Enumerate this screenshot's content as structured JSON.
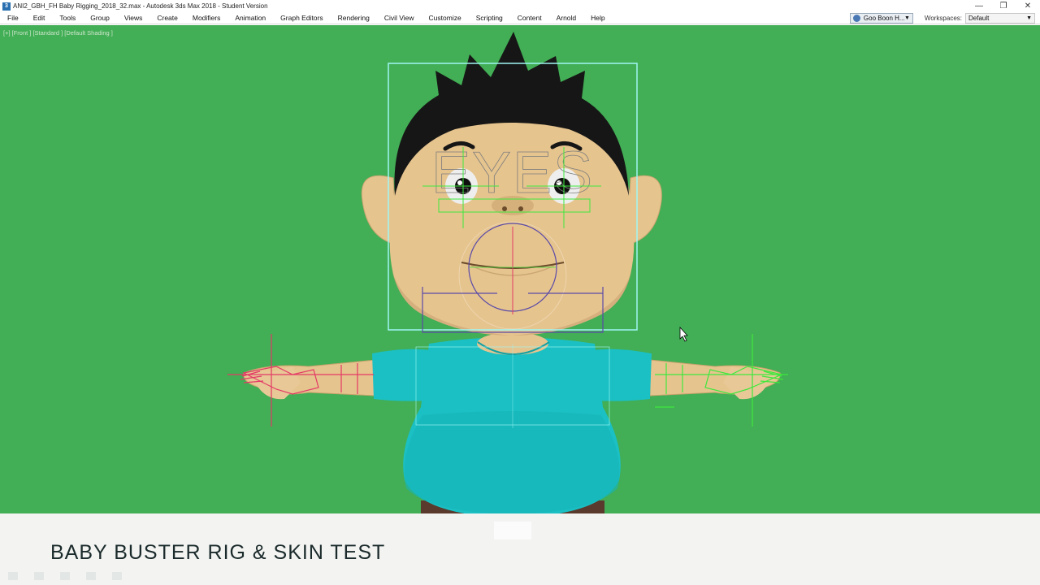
{
  "window": {
    "title": "ANI2_GBH_FH Baby Rigging_2018_32.max - Autodesk 3ds Max 2018 - Student Version",
    "controls": [
      "minimize-icon",
      "restore-icon",
      "close-icon"
    ]
  },
  "menu": {
    "items": [
      "File",
      "Edit",
      "Tools",
      "Group",
      "Views",
      "Create",
      "Modifiers",
      "Animation",
      "Graph Editors",
      "Rendering",
      "Civil View",
      "Customize",
      "Scripting",
      "Content",
      "Arnold",
      "Help"
    ],
    "user": "Goo Boon H...",
    "workspaces_label": "Workspaces:",
    "workspace_value": "Default"
  },
  "viewport": {
    "label": "[+] [Front ] [Standard ] [Default Shading ]",
    "background": "#42ae55",
    "overlay_text": "EYES"
  },
  "caption": {
    "text": "BABY BUSTER RIG & SKIN TEST"
  },
  "colors": {
    "skin": "#e6c48e",
    "shirt": "#1bc0c4",
    "hair": "#161616",
    "rig_cyan": "#9ff6f4",
    "rig_red": "#e33a66",
    "rig_green": "#3ee83e"
  }
}
